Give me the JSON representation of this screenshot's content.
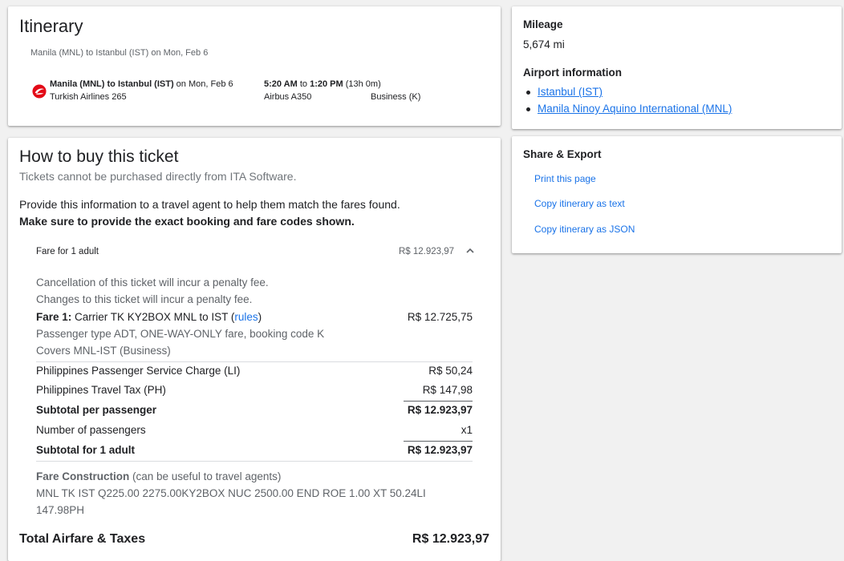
{
  "itinerary": {
    "title": "Itinerary",
    "route_summary": "Manila (MNL) to Istanbul (IST) on Mon, Feb 6",
    "segment": {
      "from": "Manila (MNL)",
      "to_word": " to ",
      "to": "Istanbul (IST)",
      "date": " on Mon, Feb 6",
      "airline": "Turkish Airlines 265",
      "depart": "5:20 AM",
      "time_to": " to ",
      "arrive": "1:20 PM",
      "duration": " (13h 0m)",
      "aircraft": "Airbus A350",
      "cabin": "Business (K)",
      "logo_icon": "turkish-airlines-logo",
      "logo_color": "#e30a17"
    }
  },
  "buy": {
    "title": "How to buy this ticket",
    "subtitle": "Tickets cannot be purchased directly from ITA Software.",
    "info": "Provide this information to a travel agent to help them match the fares found.",
    "warning": "Make sure to provide the exact booking and fare codes shown.",
    "fare_header": {
      "label": "Fare for 1 adult",
      "amount": "R$ 12.923,97",
      "icon": "chevron-up-icon"
    },
    "penalty1": "Cancellation of this ticket will incur a penalty fee.",
    "penalty2": "Changes to this ticket will incur a penalty fee.",
    "fare1": {
      "label": "Fare 1:",
      "desc": " Carrier TK KY2BOX MNL to IST (",
      "rules": "rules",
      "close": ")",
      "amount": "R$ 12.725,75",
      "detail1": "Passenger type ADT, ONE-WAY-ONLY fare, booking code K",
      "detail2": "Covers MNL-IST (Business)"
    },
    "taxes": [
      {
        "label": "Philippines Passenger Service Charge (LI)",
        "amount": "R$ 50,24"
      },
      {
        "label": "Philippines Travel Tax (PH)",
        "amount": "R$ 147,98"
      }
    ],
    "subtotal_pp": {
      "label": "Subtotal per passenger",
      "amount": "R$ 12.923,97"
    },
    "passengers": {
      "label": "Number of passengers",
      "amount": "x1"
    },
    "subtotal": {
      "label": "Subtotal for 1 adult",
      "amount": "R$ 12.923,97"
    },
    "fare_construction": {
      "label": "Fare Construction",
      "note": " (can be useful to travel agents)",
      "line1": "MNL TK IST Q225.00 2275.00KY2BOX NUC 2500.00 END ROE 1.00 XT 50.24LI",
      "line2": "147.98PH"
    },
    "total": {
      "label": "Total Airfare & Taxes",
      "amount": "R$ 12.923,97"
    }
  },
  "mileage": {
    "title": "Mileage",
    "value": "5,674 mi",
    "airport_title": "Airport information",
    "airports": [
      "Istanbul (IST)",
      "Manila Ninoy Aquino International (MNL)"
    ]
  },
  "share": {
    "title": "Share & Export",
    "links": [
      "Print this page",
      "Copy itinerary as text",
      "Copy itinerary as JSON"
    ]
  },
  "colors": {
    "link": "#1a73e8",
    "text": "#202124",
    "muted": "#5f6368",
    "background": "#f1f1f1"
  }
}
